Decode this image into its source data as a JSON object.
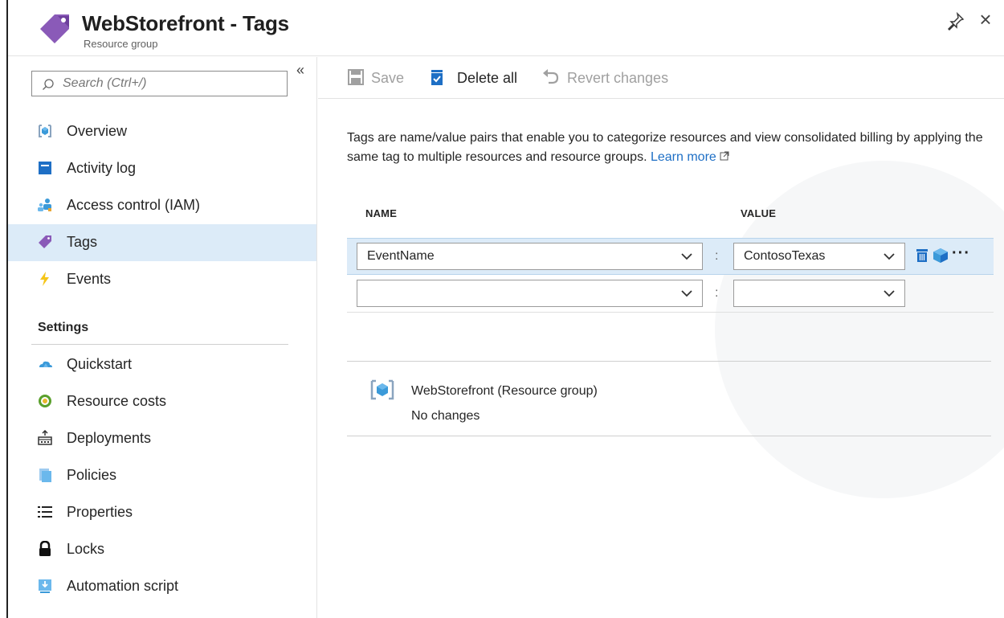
{
  "header": {
    "title": "WebStorefront - Tags",
    "subtitle": "Resource group"
  },
  "sidebar": {
    "search_placeholder": "Search (Ctrl+/)",
    "collapse_label": "«",
    "items": [
      {
        "label": "Overview",
        "icon": "resource-group-icon"
      },
      {
        "label": "Activity log",
        "icon": "activity-log-icon"
      },
      {
        "label": "Access control (IAM)",
        "icon": "access-control-icon"
      },
      {
        "label": "Tags",
        "icon": "tag-icon",
        "active": true
      },
      {
        "label": "Events",
        "icon": "lightning-icon"
      }
    ],
    "settings_title": "Settings",
    "settings_items": [
      {
        "label": "Quickstart",
        "icon": "cloud-icon"
      },
      {
        "label": "Resource costs",
        "icon": "cost-icon"
      },
      {
        "label": "Deployments",
        "icon": "deployments-icon"
      },
      {
        "label": "Policies",
        "icon": "policy-icon"
      },
      {
        "label": "Properties",
        "icon": "properties-icon"
      },
      {
        "label": "Locks",
        "icon": "lock-icon"
      },
      {
        "label": "Automation script",
        "icon": "automation-icon"
      }
    ]
  },
  "toolbar": {
    "save_label": "Save",
    "delete_all_label": "Delete all",
    "revert_label": "Revert changes"
  },
  "main": {
    "description": "Tags are name/value pairs that enable you to categorize resources and view consolidated billing by applying the same tag to multiple resources and resource groups.",
    "learn_more": "Learn more",
    "col_name": "NAME",
    "col_value": "VALUE",
    "colon": ":",
    "rows": [
      {
        "name": "EventName",
        "value": "ContosoTexas"
      },
      {
        "name": "",
        "value": ""
      }
    ],
    "resource_name": "WebStorefront (Resource group)",
    "resource_status": "No changes"
  },
  "colors": {
    "accent": "#1e6fc5",
    "tag_purple": "#8a5ab8",
    "selection": "#dcebf8"
  }
}
